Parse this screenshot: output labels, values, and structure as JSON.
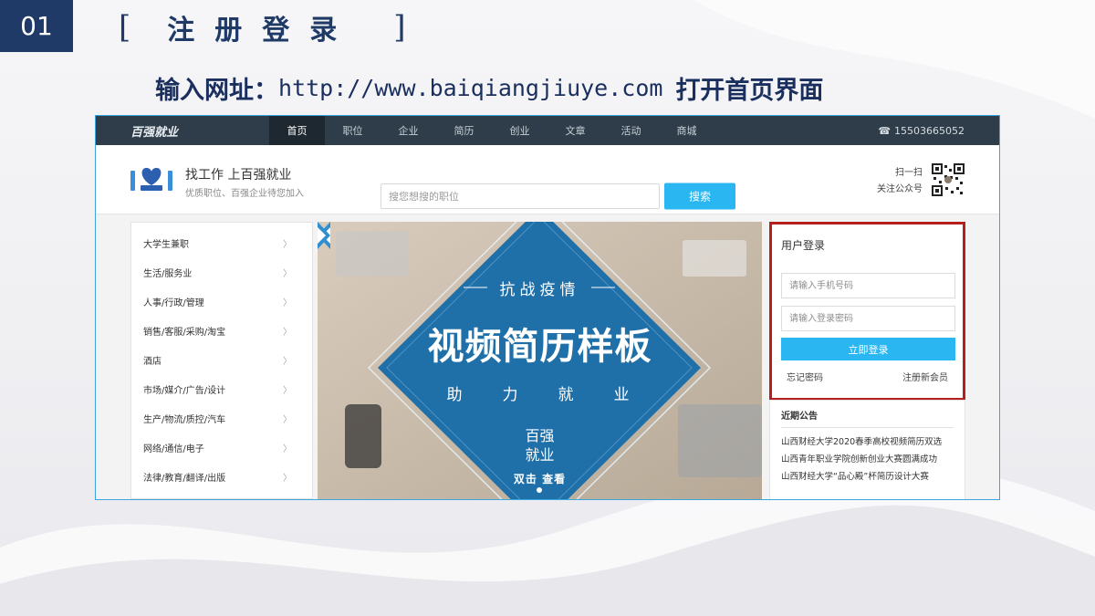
{
  "slide": {
    "step_number": "01",
    "bracket_left": "[",
    "title": "注册登录",
    "bracket_right": "]",
    "instruction_prefix": "输入网址：",
    "url": "http://www.baiqiangjiuye.com",
    "instruction_suffix": "打开首页界面"
  },
  "site": {
    "brand": "百强就业",
    "nav": [
      "首页",
      "职位",
      "企业",
      "简历",
      "创业",
      "文章",
      "活动",
      "商城"
    ],
    "nav_active_index": 0,
    "phone": "15503665052",
    "slogan": "找工作  上百强就业",
    "slogan_sub": "优质职位、百强企业待您加入",
    "search": {
      "placeholder": "搜您想搜的职位",
      "button": "搜索"
    },
    "qr": {
      "line1": "扫一扫",
      "line2": "关注公众号"
    },
    "categories": [
      "大学生兼职",
      "生活/服务业",
      "人事/行政/管理",
      "销售/客服/采购/淘宝",
      "酒店",
      "市场/媒介/广告/设计",
      "生产/物流/质控/汽车",
      "网络/通信/电子",
      "法律/教育/翻译/出版"
    ],
    "banner": {
      "kicker": "抗战疫情",
      "title": "视频简历样板",
      "subtitle": "助力就业",
      "brand_line1": "百强",
      "brand_line2": "就业",
      "cta": "双击 查看"
    },
    "login": {
      "title": "用户登录",
      "phone_placeholder": "请输入手机号码",
      "password_placeholder": "请输入登录密码",
      "submit": "立即登录",
      "forgot": "忘记密码",
      "register": "注册新会员"
    },
    "notices": {
      "title": "近期公告",
      "items": [
        "山西财经大学2020春季高校视频简历双选",
        "山西青年职业学院创新创业大赛圆满成功",
        "山西财经大学“品心殿”杯简历设计大赛"
      ]
    }
  },
  "colors": {
    "slide_accent": "#1f3a66",
    "nav_bg": "#2e3d49",
    "button_blue": "#29b6f1",
    "highlight_red": "#b5201e",
    "banner_blue": "#1f6fa8"
  }
}
